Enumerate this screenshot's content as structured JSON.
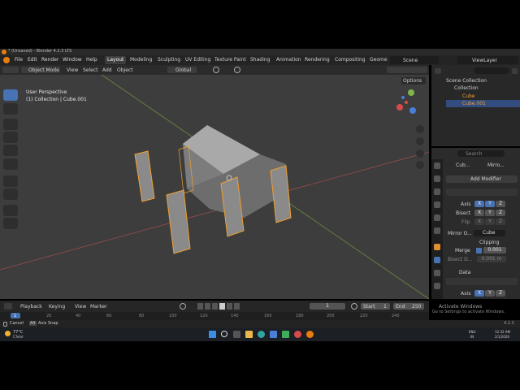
{
  "window": {
    "title": "* (Unsaved) - Blender 4.2.3 LTS"
  },
  "menu": {
    "items": [
      "File",
      "Edit",
      "Render",
      "Window",
      "Help"
    ]
  },
  "workspaces": [
    "Layout",
    "Modeling",
    "Sculpting",
    "UV Editing",
    "Texture Paint",
    "Shading",
    "Animation",
    "Rendering",
    "Compositing",
    "Geome"
  ],
  "scene": {
    "label": "Scene",
    "view_layer": "ViewLayer"
  },
  "viewport_header": {
    "mode": "Object Mode",
    "menus": [
      "View",
      "Select",
      "Add",
      "Object"
    ],
    "orientation": "Global",
    "options": "Options"
  },
  "viewport": {
    "perspective": "User Perspective",
    "collection": "(1) Collection | Cube.001"
  },
  "outliner": {
    "search_placeholder": "",
    "root": "Scene Collection",
    "items": [
      {
        "name": "Collection"
      },
      {
        "name": "Cube"
      },
      {
        "name": "Cube.001"
      }
    ]
  },
  "properties": {
    "search_placeholder": "Search",
    "object": "Cub...",
    "modifier_short": "Mirro...",
    "add_modifier": "Add Modifier",
    "axis_label": "Axis",
    "bisect_label": "Bisect",
    "flip_label": "Flip",
    "x": "X",
    "y": "Y",
    "z": "Z",
    "mirror_object_label": "Mirror O...",
    "mirror_object_value": "Cube",
    "clipping_label": "Clipping",
    "merge_label": "Merge",
    "merge_value": "0.001",
    "bisect_distance_label": "Bisect D...",
    "bisect_distance_value": "0.001 m",
    "data_label": "Data",
    "activate_windows": "Activate Windows",
    "activate_windows_sub": "Go to Settings to activate Windows."
  },
  "timeline": {
    "menus": [
      "Playback",
      "Keying",
      "View",
      "Marker"
    ],
    "current_frame": "1",
    "start_label": "Start",
    "start_value": "1",
    "end_label": "End",
    "end_value": "250",
    "ticks": [
      "1",
      "20",
      "40",
      "60",
      "80",
      "100",
      "120",
      "140",
      "160",
      "180",
      "200",
      "220",
      "240"
    ]
  },
  "statusbar": {
    "cancel": "Cancel",
    "key": "Alt",
    "axis_snap": "Axis Snap",
    "version": "4.2.3"
  },
  "taskbar": {
    "weather_temp": "77°C",
    "weather_desc": "Clear",
    "lang_top": "ENG",
    "lang_bottom": "IN",
    "time": "12:32 AM",
    "date": "2/1/2026"
  },
  "colors": {
    "accent": "#4772b3",
    "selection_orange": "#f0a030",
    "axis_x": "#d94a4a",
    "axis_y": "#7fb54a",
    "axis_z": "#4a7fd9"
  }
}
